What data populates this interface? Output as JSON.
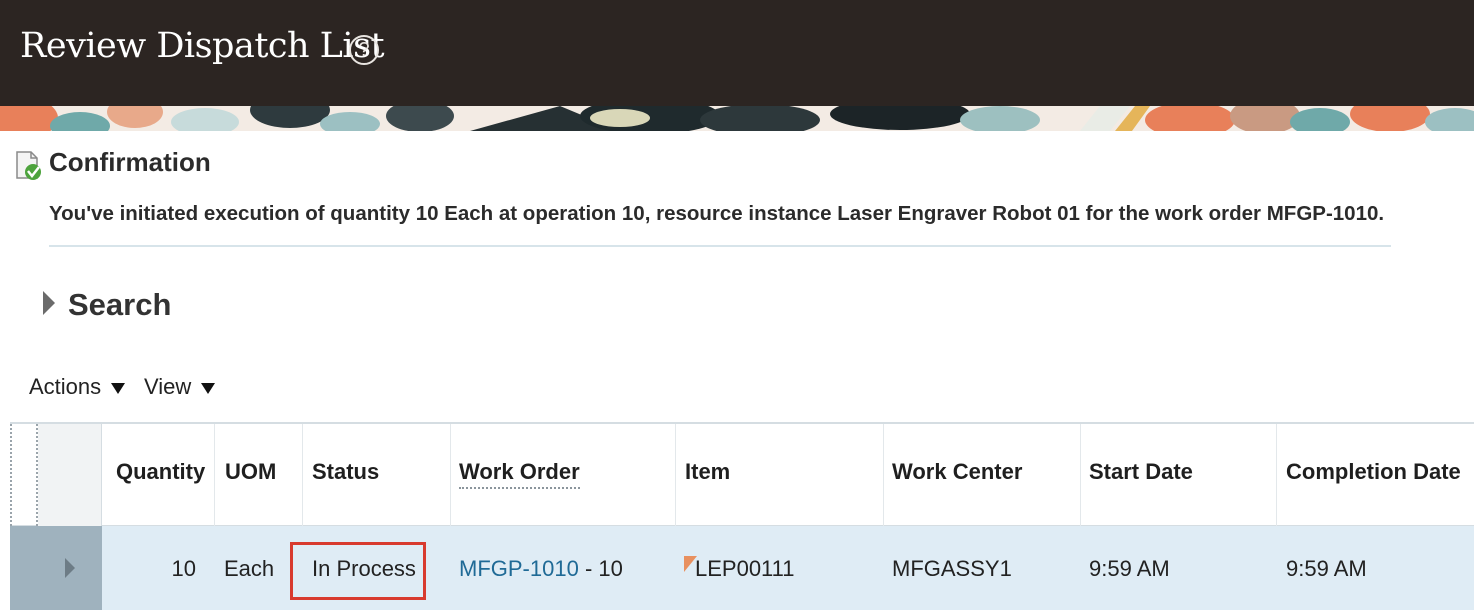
{
  "header": {
    "title": "Review Dispatch List",
    "help_icon": "?"
  },
  "confirmation": {
    "title": "Confirmation",
    "message": "You've initiated execution of quantity 10 Each at operation 10, resource instance Laser Engraver Robot 01 for the work order MFGP-1010."
  },
  "search": {
    "label": "Search"
  },
  "toolbar": {
    "actions_label": "Actions",
    "view_label": "View"
  },
  "table": {
    "columns": [
      "Quantity",
      "UOM",
      "Status",
      "Work Order",
      "Item",
      "Work Center",
      "Start Date",
      "Completion Date"
    ],
    "rows": [
      {
        "quantity": "10",
        "uom": "Each",
        "status": "In Process",
        "work_order": "MFGP-1010",
        "operation_suffix": " - 10",
        "item": "LEP00111",
        "work_center": "MFGASSY1",
        "start_date": "9:59 AM",
        "completion_date": "9:59 AM"
      }
    ]
  },
  "colors": {
    "header_bg": "#2c2522",
    "selected_row_bg": "#dfecf5",
    "link": "#1f6a96",
    "status_highlight": "#d83a2e"
  }
}
